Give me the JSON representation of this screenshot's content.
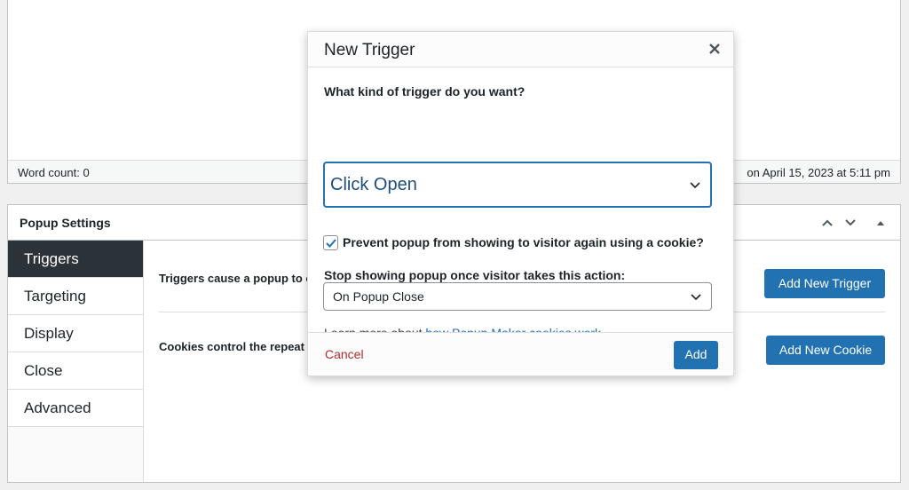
{
  "editor": {
    "word_count": "Word count: 0",
    "last_edited": "on April 15, 2023 at 5:11 pm"
  },
  "metabox": {
    "title": "Popup Settings",
    "tabs": [
      {
        "label": "Triggers",
        "active": true
      },
      {
        "label": "Targeting",
        "active": false
      },
      {
        "label": "Display",
        "active": false
      },
      {
        "label": "Close",
        "active": false
      },
      {
        "label": "Advanced",
        "active": false
      }
    ],
    "triggers_text": "Triggers cause a popup to o",
    "cookies_text": "Cookies control the repeat",
    "add_trigger_label": "Add New Trigger",
    "add_cookie_label": "Add New Cookie"
  },
  "modal": {
    "title": "New Trigger",
    "close_icon": "close-icon",
    "question": "What kind of trigger do you want?",
    "trigger_type": "Click Open",
    "cookie_checkbox_checked": true,
    "cookie_checkbox_label": "Prevent popup from showing to visitor again using a cookie?",
    "stop_label": "Stop showing popup once visitor takes this action:",
    "stop_action": "On Popup Close",
    "learn_prefix": "Learn more about ",
    "learn_link": "how Popup Maker cookies work",
    "learn_suffix": ".",
    "cancel_label": "Cancel",
    "add_label": "Add"
  },
  "colors": {
    "primary": "#2271b1",
    "active_tab": "#2c3338",
    "cancel": "#b32d2e"
  }
}
